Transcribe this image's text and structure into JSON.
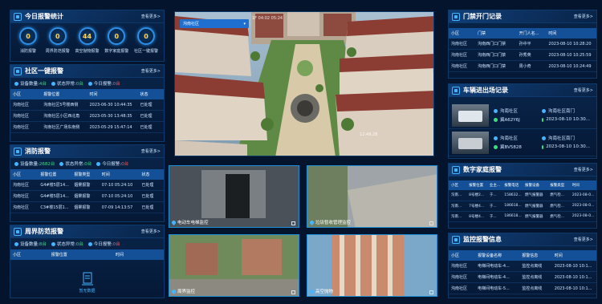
{
  "today_alarm": {
    "title": "今日报警统计",
    "more": "查看更多>",
    "items": [
      {
        "value": "0",
        "label": "消防报警"
      },
      {
        "value": "0",
        "label": "周界防范报警"
      },
      {
        "value": "44",
        "label": "高空抛物报警"
      },
      {
        "value": "0",
        "label": "数字家庭报警"
      },
      {
        "value": "0",
        "label": "社区一键报警"
      }
    ]
  },
  "one_key": {
    "title": "社区一键报警",
    "more": "查看更多>",
    "stat1_label": "设备数量:",
    "stat1_value": "4台",
    "stat2_label": "状态异常:",
    "stat2_value": "0台",
    "stat3_label": "今日报警:",
    "stat3_value": "0台",
    "headers": [
      "小区",
      "报警位置",
      "时间",
      "状态"
    ],
    "rows": [
      [
        "沟南社区",
        "沟南社区5号楼西侧",
        "2023-06-30 10:44:35",
        "已处理"
      ],
      [
        "沟南社区",
        "沟南社区小区西北角",
        "2023-05-30 13:48:35",
        "已处理"
      ],
      [
        "沟南社区",
        "沟南社区广场东南侧",
        "2023-05-29 15:47:14",
        "已处理"
      ]
    ]
  },
  "fire": {
    "title": "消防报警",
    "more": "查看更多>",
    "stat1_label": "设备数量:",
    "stat1_value": "2682台",
    "stat2_label": "状态异常:",
    "stat2_value": "0台",
    "stat3_label": "今日报警:",
    "stat3_value": "0台",
    "headers": [
      "小区",
      "报警位置",
      "报警类型",
      "时间",
      "状态"
    ],
    "rows": [
      [
        "沟南社区",
        "G4#楼5层14...",
        "烟雾报警",
        "07-10 05:24:10",
        "已处理"
      ],
      [
        "沟南社区",
        "G4#楼5层14...",
        "烟雾报警",
        "07-10 05:24:10",
        "已处理"
      ],
      [
        "沟南社区",
        "C3#楼15层1...",
        "烟雾报警",
        "07-09 14:13:57",
        "已处理"
      ]
    ]
  },
  "perimeter": {
    "title": "周界防范报警",
    "more": "查看更多>",
    "stat1_label": "设备数量:",
    "stat1_value": "8台",
    "stat2_label": "状态异常:",
    "stat2_value": "0台",
    "stat3_label": "今日报警:",
    "stat3_value": "0台",
    "headers": [
      "小区",
      "报警位置",
      "时间"
    ],
    "empty_text": "暂无数据"
  },
  "aerial": {
    "select_value": "沟南社区",
    "overlay_top": "1F 04:02 05:24",
    "overlay_bottom": "12:49:28"
  },
  "cameras": [
    {
      "label": "电动车电梯监控",
      "status": "LIVE"
    },
    {
      "label": "垃圾暂收管理监控",
      "status": "LIVE"
    },
    {
      "label": "周界监控",
      "status": "LIVE"
    },
    {
      "label": "高空抛物",
      "status": "LIVE"
    }
  ],
  "access": {
    "title": "门禁开门记录",
    "more": "查看更多>",
    "headers": [
      "小区",
      "门禁",
      "开门人名...",
      "时间"
    ],
    "rows": [
      [
        "沟南社区",
        "沟南西门口门禁",
        "孙中平",
        "2023-08-10 10:28:20"
      ],
      [
        "沟南社区",
        "沟南西门口门禁",
        "孙秀英",
        "2023-08-10 10:25:59"
      ],
      [
        "沟南社区",
        "沟南西门口门禁",
        "周小奇",
        "2023-08-10 10:24:49"
      ]
    ]
  },
  "vehicle": {
    "title": "车辆进出场记录",
    "more": "查看更多>",
    "rows": [
      {
        "community": "沟南社区",
        "gate": "沟南社区南门",
        "plate": "冀A62Y6J",
        "time": "2023-08-10 10:30..."
      },
      {
        "community": "沟南社区",
        "gate": "沟南社区南门",
        "plate": "冀BV5828",
        "time": "2023-08-10 10:30..."
      }
    ]
  },
  "digital_home": {
    "title": "数字家庭报警",
    "more": "查看更多>",
    "headers": [
      "小区",
      "报警位置",
      "业主...",
      "报警电话",
      "报警设备",
      "报警类型",
      "时间"
    ],
    "rows": [
      [
        "沟南...",
        "8号楼2...",
        "于...",
        "158632...",
        "燃气报警器",
        "燃气检...",
        "2023-08-0..."
      ],
      [
        "沟南...",
        "7号楼4...",
        "于...",
        "186618...",
        "燃气报警器",
        "燃气检...",
        "2023-08-0..."
      ],
      [
        "沟南...",
        "8号楼4...",
        "于...",
        "186618...",
        "燃气报警器",
        "燃气检...",
        "2023-08-0..."
      ]
    ]
  },
  "monitor": {
    "title": "监控报警信息",
    "more": "查看更多>",
    "headers": [
      "小区",
      "报警设备名称",
      "报警信息",
      "时间"
    ],
    "rows": [
      [
        "沟南社区",
        "电梯间电动车-4...",
        "监控点离线",
        "2023-08-10 10:1..."
      ],
      [
        "沟南社区",
        "电梯间电动车-4...",
        "监控点离线",
        "2023-08-10 10:1..."
      ],
      [
        "沟南社区",
        "电梯间电动车-5...",
        "监控点离线",
        "2023-08-10 10:1..."
      ]
    ]
  }
}
